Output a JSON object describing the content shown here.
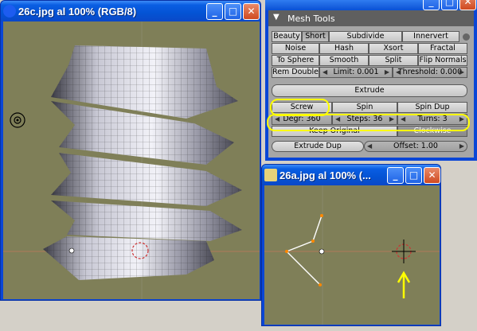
{
  "window1": {
    "title": "26c.jpg al 100% (RGB/8)",
    "min": "_",
    "max": "□",
    "close": "✕"
  },
  "window2": {
    "title": "26a.jpg al 100% (...",
    "min": "_",
    "max": "□",
    "close": "✕"
  },
  "panel": {
    "title": "Mesh Tools",
    "collapse": "▼",
    "row1": [
      "Beauty",
      "Short",
      "Subdivide",
      "Innervert"
    ],
    "row2": [
      "Noise",
      "Hash",
      "Xsort",
      "Fractal"
    ],
    "row3": [
      "To Sphere",
      "Smooth",
      "Split",
      "Flip Normals"
    ],
    "rem_double": "Rem Double",
    "limit": "Limit: 0.001",
    "threshold": "Threshold: 0.000",
    "extrude": "Extrude",
    "screw": "Screw",
    "spin": "Spin",
    "spin_dup": "Spin Dup",
    "degr": "Degr: 360",
    "steps": "Steps: 36",
    "turns": "Turns: 3",
    "keep_original": "Keep Original",
    "clockwise": "Clockwise",
    "extrude_dup": "Extrude Dup",
    "offset": "Offset: 1.00"
  },
  "colors": {
    "viewport": "#7f7f58",
    "highlight": "#ffff00",
    "title_blue": "#0a46d6"
  }
}
